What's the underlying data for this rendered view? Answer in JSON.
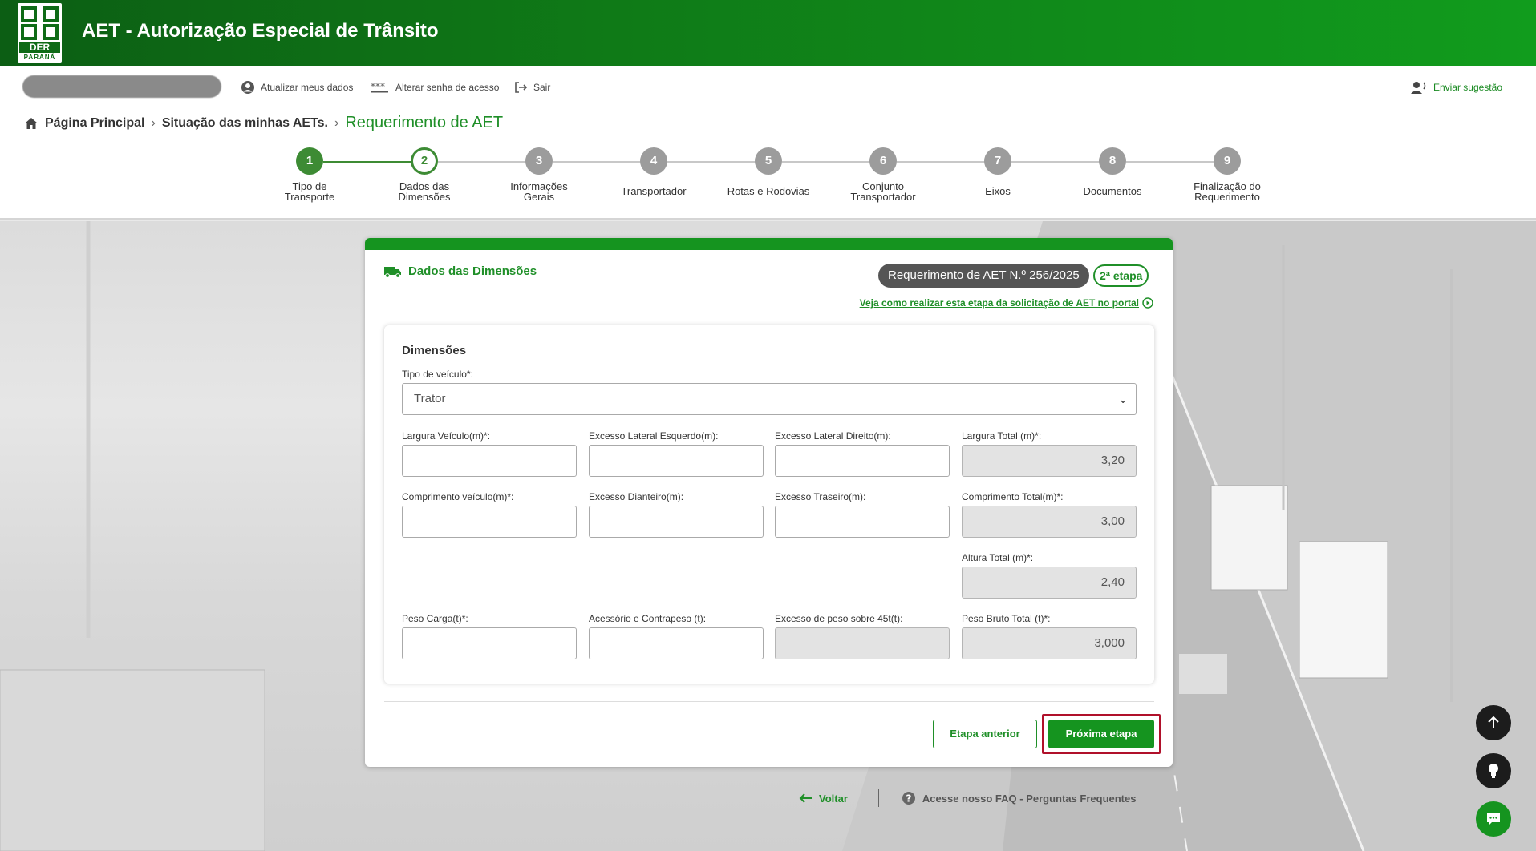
{
  "header": {
    "app_title": "AET - Autorização Especial de Trânsito",
    "logo_text": "DER",
    "logo_subtext": "PARANÁ"
  },
  "userbar": {
    "update_data": "Atualizar meus dados",
    "change_password": "Alterar senha de acesso",
    "logout": "Sair",
    "send_suggestion": "Enviar sugestão"
  },
  "breadcrumb": {
    "home": "Página Principal",
    "item2": "Situação das minhas AETs.",
    "current": "Requerimento de AET"
  },
  "steps": [
    {
      "num": "1",
      "l1": "Tipo de",
      "l2": "Transporte",
      "state": "done"
    },
    {
      "num": "2",
      "l1": "Dados das",
      "l2": "Dimensões",
      "state": "active"
    },
    {
      "num": "3",
      "l1": "Informações",
      "l2": "Gerais",
      "state": "todo"
    },
    {
      "num": "4",
      "l1": "Transportador",
      "l2": "",
      "state": "todo"
    },
    {
      "num": "5",
      "l1": "Rotas e Rodovias",
      "l2": "",
      "state": "todo"
    },
    {
      "num": "6",
      "l1": "Conjunto",
      "l2": "Transportador",
      "state": "todo"
    },
    {
      "num": "7",
      "l1": "Eixos",
      "l2": "",
      "state": "todo"
    },
    {
      "num": "8",
      "l1": "Documentos",
      "l2": "",
      "state": "todo"
    },
    {
      "num": "9",
      "l1": "Finalização do",
      "l2": "Requerimento",
      "state": "todo"
    }
  ],
  "card": {
    "title": "Dados das Dimensões",
    "request_badge": "Requerimento de AET N.º 256/2025",
    "stage_badge": "2ª etapa",
    "help_link": "Veja como realizar esta etapa da solicitação de AET no portal"
  },
  "form": {
    "section_title": "Dimensões",
    "vehicle_type_label": "Tipo de veículo*:",
    "vehicle_type_value": "Trator",
    "fields": {
      "largura_veiculo": {
        "label": "Largura Veículo(m)*:",
        "value": ""
      },
      "excesso_lat_esq": {
        "label": "Excesso Lateral Esquerdo(m):",
        "value": ""
      },
      "excesso_lat_dir": {
        "label": "Excesso Lateral Direito(m):",
        "value": ""
      },
      "largura_total": {
        "label": "Largura Total (m)*:",
        "value": "3,20"
      },
      "comprimento_veiculo": {
        "label": "Comprimento veículo(m)*:",
        "value": ""
      },
      "excesso_dianteiro": {
        "label": "Excesso Dianteiro(m):",
        "value": ""
      },
      "excesso_traseiro": {
        "label": "Excesso Traseiro(m):",
        "value": ""
      },
      "comprimento_total": {
        "label": "Comprimento Total(m)*:",
        "value": "3,00"
      },
      "altura_total": {
        "label": "Altura Total (m)*:",
        "value": "2,40"
      },
      "peso_carga": {
        "label": "Peso Carga(t)*:",
        "value": ""
      },
      "acessorio": {
        "label": "Acessório e Contrapeso (t):",
        "value": ""
      },
      "excesso_peso": {
        "label": "Excesso de peso sobre 45t(t):",
        "value": ""
      },
      "peso_bruto": {
        "label": "Peso Bruto Total (t)*:",
        "value": "3,000"
      }
    }
  },
  "buttons": {
    "previous": "Etapa anterior",
    "next": "Próxima etapa"
  },
  "footer": {
    "back": "Voltar",
    "faq": "Acesse nosso FAQ - Perguntas Frequentes"
  },
  "colors": {
    "brand_green": "#15941f",
    "header_dark": "#0c5e14",
    "highlight_red": "#b0102a"
  }
}
